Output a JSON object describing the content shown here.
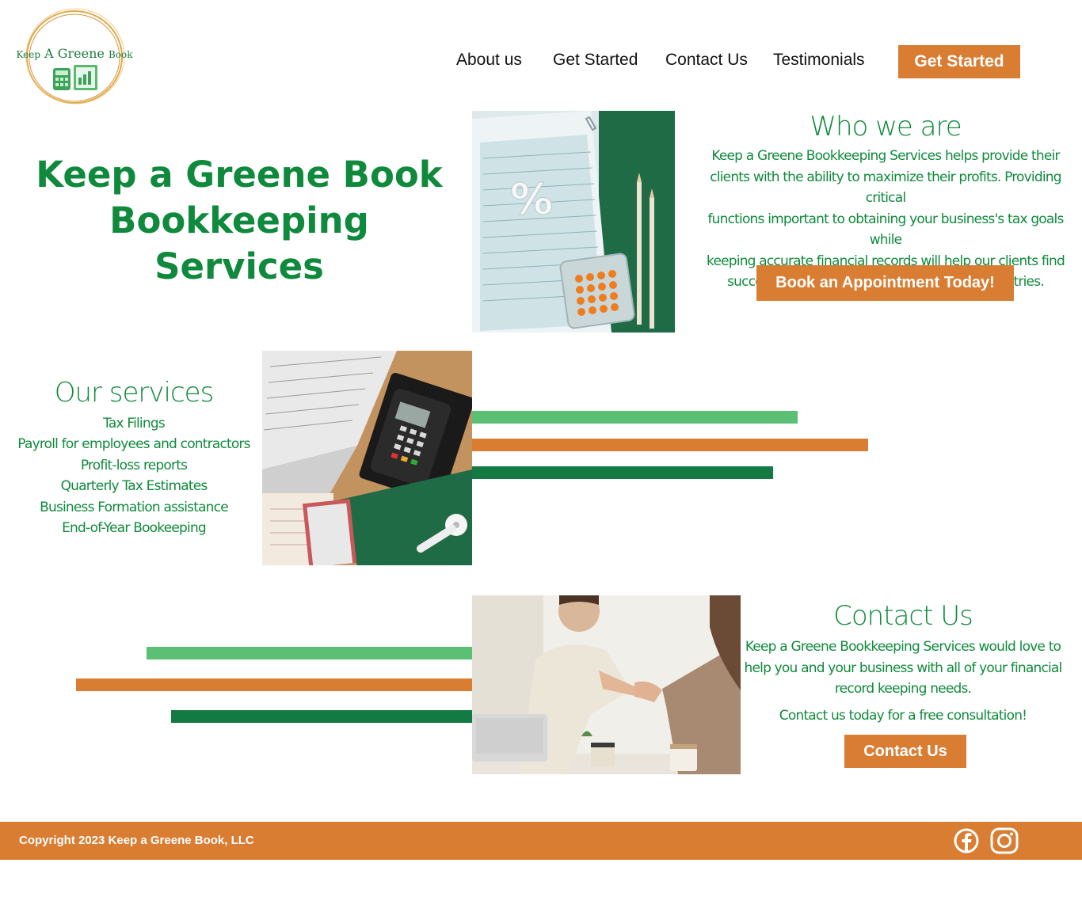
{
  "header": {
    "logo": {
      "text_keep": "Keep",
      "text_a_greene": "A Greene",
      "text_book": "Book"
    },
    "nav": [
      {
        "label": "About us"
      },
      {
        "label": "Get Started"
      },
      {
        "label": "Contact Us"
      },
      {
        "label": "Testimonials"
      }
    ],
    "cta_label": "Get Started"
  },
  "hero": {
    "title_line1": "Keep a Greene Book",
    "title_line2": "Bookkeeping",
    "title_line3": "Services"
  },
  "who": {
    "heading": "Who we are",
    "lines": [
      "Keep a Greene Bookkeeping Services helps provide their",
      "clients with the ability to maximize their profits. Providing critical",
      "functions important to obtaining your business's tax goals while",
      "keeping accurate financial records will help our clients find",
      "success and longevity in their respective industries."
    ],
    "button_label": "Book an Appointment Today!"
  },
  "services": {
    "heading": "Our services",
    "items": [
      "Tax Filings",
      "Payroll for employees and contractors",
      "Profit-loss reports",
      "Quarterly Tax Estimates",
      "Business Formation assistance",
      "End-of-Year Bookeeping"
    ]
  },
  "contact": {
    "heading": "Contact Us",
    "lines": [
      "Keep a Greene Bookkeeping Services would love to",
      "help you and your business with all of your financial",
      "record keeping needs."
    ],
    "cta_line": "Contact us today for a free consultation!",
    "button_label": "Contact Us"
  },
  "footer": {
    "copyright": "Copyright 2023 Keep a Greene Book, LLC",
    "icons": [
      "facebook-icon",
      "instagram-icon"
    ]
  },
  "colors": {
    "brand_green": "#0f8a3c",
    "accent_orange": "#d97d33",
    "light_green": "#5bbf74",
    "dark_green": "#137a43"
  }
}
